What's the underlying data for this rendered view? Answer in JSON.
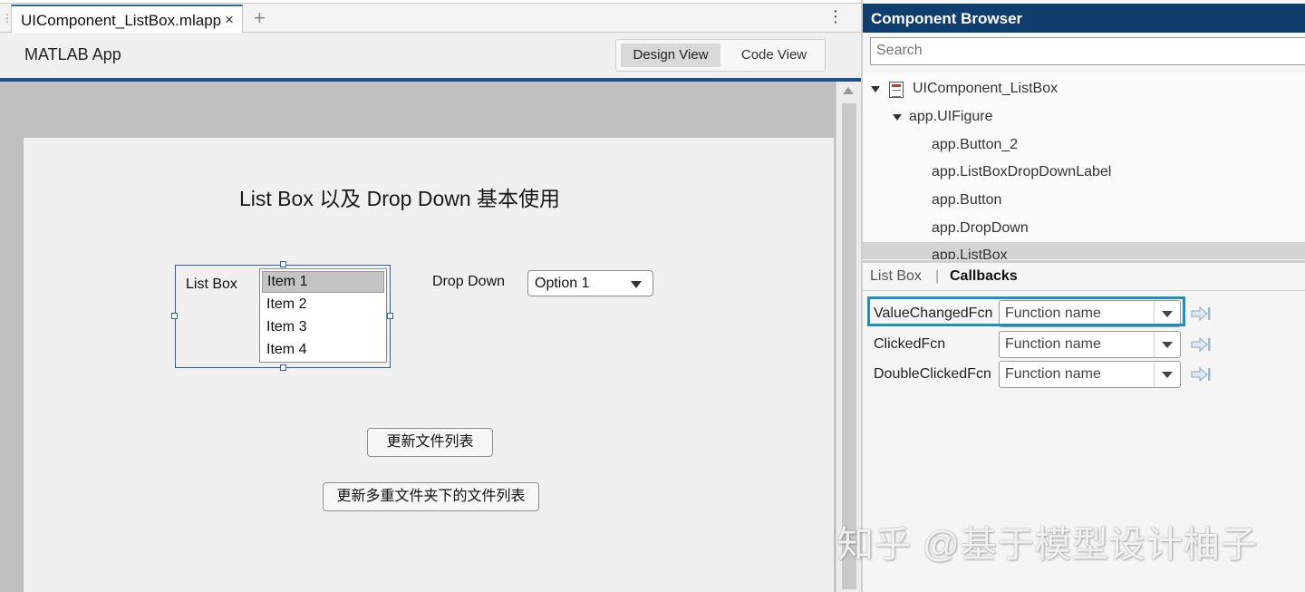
{
  "editor": {
    "tab_label": "UIComponent_ListBox.mlapp",
    "tab_close": "×",
    "tab_add": "+",
    "tab_menu": "⋮",
    "app_title": "MATLAB App",
    "design_view": "Design View",
    "code_view": "Code View"
  },
  "figure": {
    "title": "List Box 以及 Drop Down 基本使用",
    "listbox": {
      "label": "List Box",
      "items": [
        "Item 1",
        "Item 2",
        "Item 3",
        "Item 4"
      ],
      "selected": "Item 1"
    },
    "dropdown": {
      "label": "Drop Down",
      "value": "Option 1"
    },
    "buttons": {
      "update": "更新文件列表",
      "update_multi": "更新多重文件夹下的文件列表"
    }
  },
  "browser": {
    "title": "Component Browser",
    "search_placeholder": "Search",
    "tree": [
      {
        "label": "UIComponent_ListBox"
      },
      {
        "label": "app.UIFigure"
      },
      {
        "label": "app.Button_2"
      },
      {
        "label": "app.ListBoxDropDownLabel"
      },
      {
        "label": "app.Button"
      },
      {
        "label": "app.DropDown"
      },
      {
        "label": "app.ListBox"
      }
    ],
    "selected_node": "app.ListBox",
    "inspector_tabs": {
      "component": "List Box",
      "separator": "|",
      "callbacks": "Callbacks"
    },
    "callbacks": [
      {
        "name": "ValueChangedFcn",
        "placeholder": "Function name"
      },
      {
        "name": "ClickedFcn",
        "placeholder": "Function name"
      },
      {
        "name": "DoubleClickedFcn",
        "placeholder": "Function name"
      }
    ],
    "highlighted_callback": "ValueChangedFcn"
  },
  "watermark": "知乎 @基于模型设计柚子",
  "colors": {
    "accent": "#1f4e8c",
    "browser_header": "#0f3d6e",
    "highlight": "#1c8fc4",
    "selection": "#c4c4c4"
  }
}
